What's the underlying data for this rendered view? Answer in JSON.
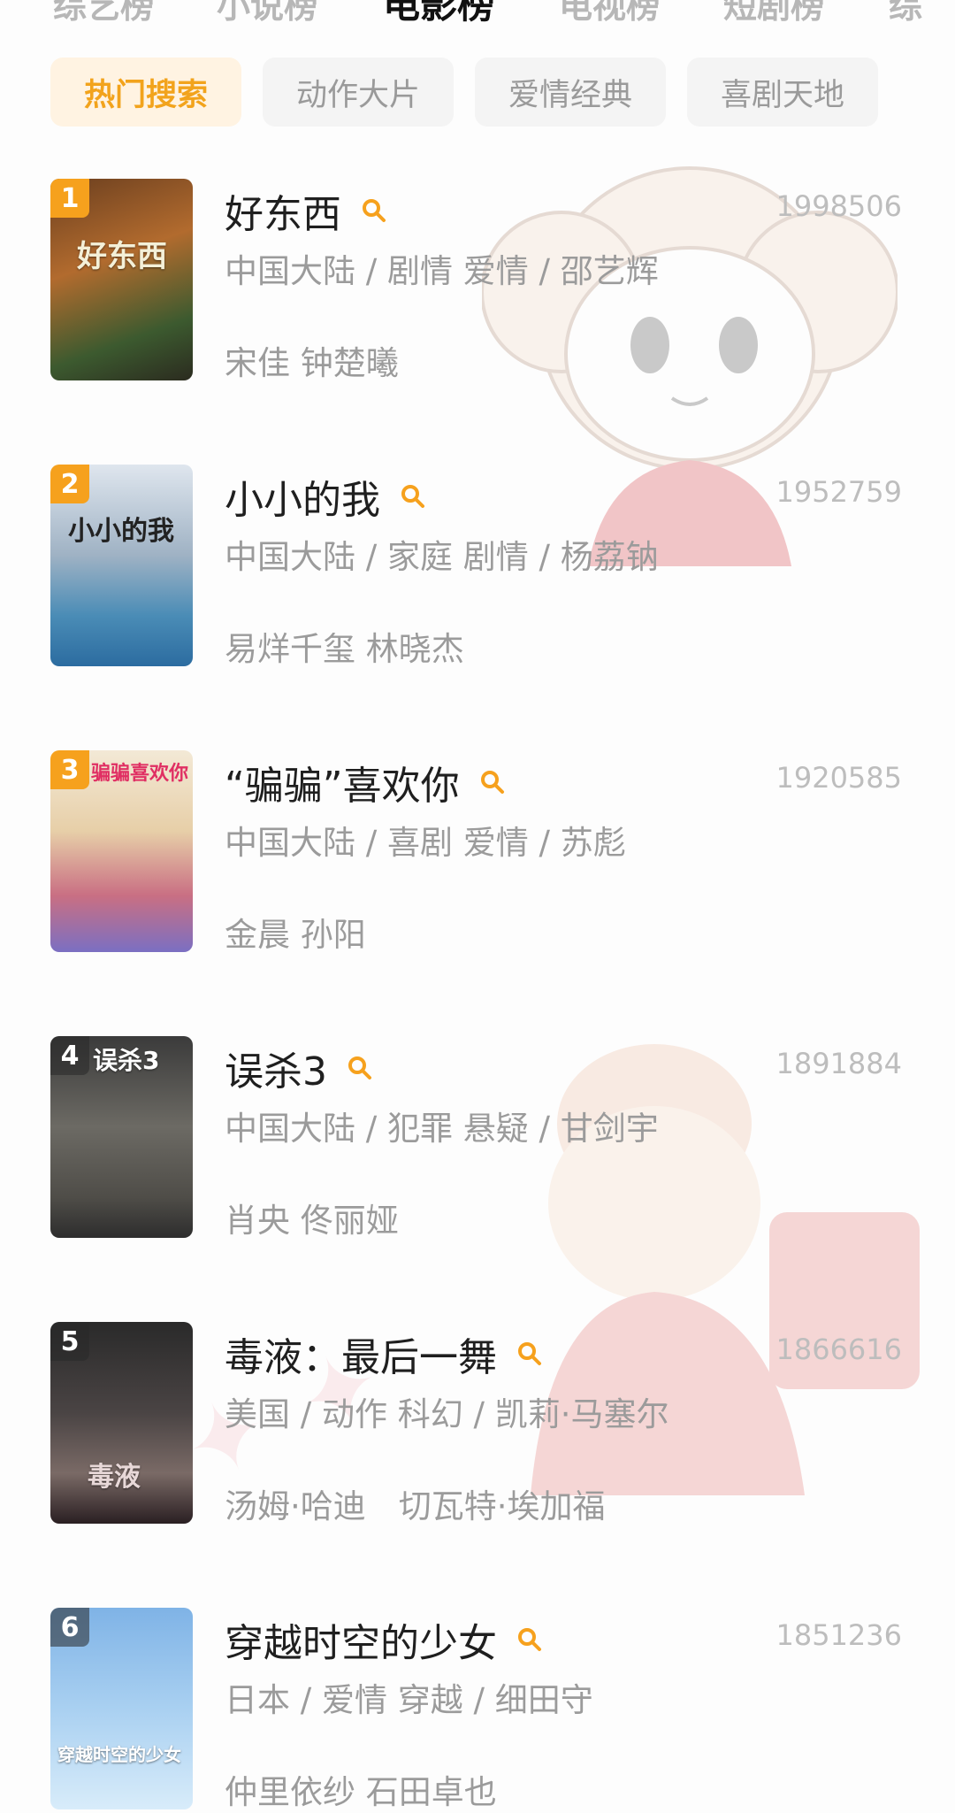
{
  "top_tabs": [
    {
      "label": "综艺榜"
    },
    {
      "label": "小说榜"
    },
    {
      "label": "电影榜"
    },
    {
      "label": "电视榜"
    },
    {
      "label": "短剧榜"
    },
    {
      "label": "综"
    }
  ],
  "filter_chips": [
    {
      "label": "热门搜索"
    },
    {
      "label": "动作大片"
    },
    {
      "label": "爱情经典"
    },
    {
      "label": "喜剧天地"
    }
  ],
  "movies": [
    {
      "rank": "1",
      "title": "好东西",
      "score": "1998506",
      "meta": "中国大陆 / 剧情 爱情 / 邵艺辉",
      "cast": "宋佳 钟楚曦",
      "poster_text": "好东西"
    },
    {
      "rank": "2",
      "title": "小小的我",
      "score": "1952759",
      "meta": "中国大陆 / 家庭 剧情 / 杨荔钠",
      "cast": "易烊千玺 林晓杰",
      "poster_text": "小小的我"
    },
    {
      "rank": "3",
      "title": "“骗骗”喜欢你",
      "score": "1920585",
      "meta": "中国大陆 / 喜剧 爱情 / 苏彪",
      "cast": "金晨 孙阳",
      "poster_text": "骗骗喜欢你"
    },
    {
      "rank": "4",
      "title": "误杀3",
      "score": "1891884",
      "meta": "中国大陆 / 犯罪 悬疑 / 甘剑宇",
      "cast": "肖央 佟丽娅",
      "poster_text": "误杀3"
    },
    {
      "rank": "5",
      "title": "毒液：最后一舞",
      "score": "1866616",
      "meta": "美国 / 动作 科幻 / 凯莉·马塞尔",
      "cast": "汤姆·哈迪　切瓦特·埃加福",
      "poster_text": "毒液"
    },
    {
      "rank": "6",
      "title": "穿越时空的少女",
      "score": "1851236",
      "meta": "日本 / 爱情 穿越 / 细田守",
      "cast": "仲里依纱 石田卓也",
      "poster_text": "穿越时空的少女"
    }
  ],
  "colors": {
    "accent": "#f6a11d",
    "active_chip_bg": "#fff3e2",
    "muted_text": "#9b9b9b"
  }
}
